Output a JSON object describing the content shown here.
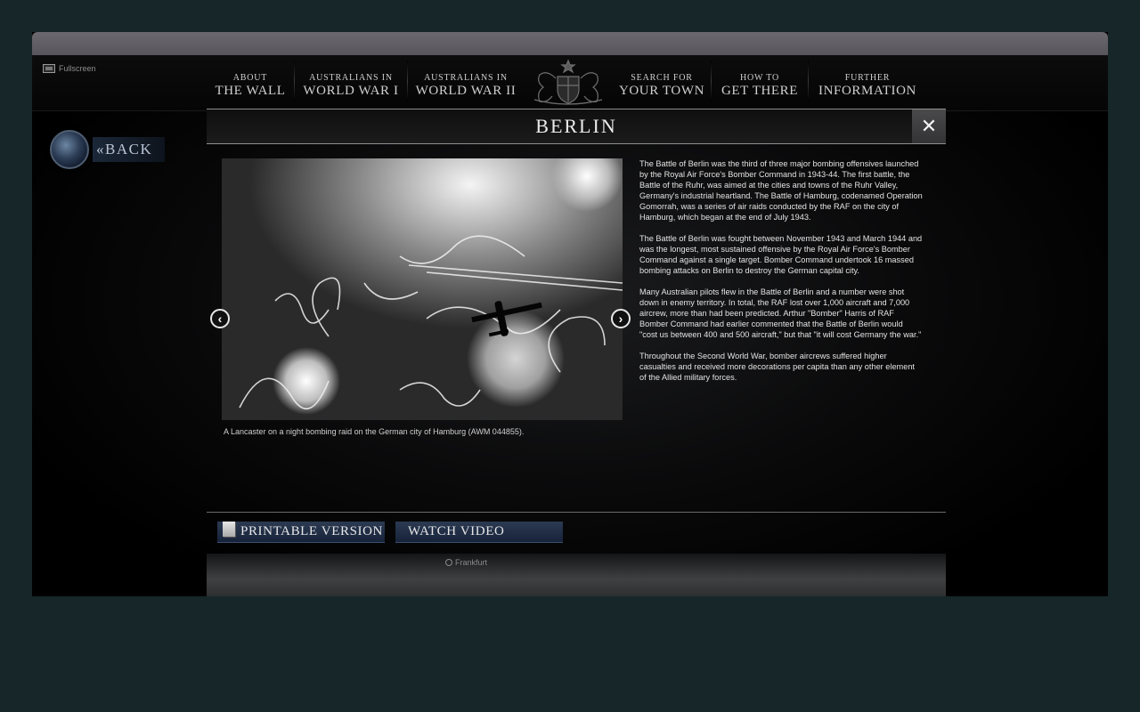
{
  "window": {
    "fullscreen_label": "Fullscreen"
  },
  "nav": {
    "items": [
      {
        "line1": "About",
        "line2": "The Wall"
      },
      {
        "line1": "Australians in",
        "line2": "World War I"
      },
      {
        "line1": "Australians in",
        "line2": "World War II"
      },
      {
        "line1": "Search For",
        "line2": "Your Town"
      },
      {
        "line1": "How To",
        "line2": "Get There"
      },
      {
        "line1": "Further",
        "line2": "Information"
      }
    ]
  },
  "back": {
    "label": "«Back"
  },
  "panel": {
    "title": "Berlin",
    "close_label": "✕",
    "prev_label": "‹",
    "next_label": "›",
    "caption": "A Lancaster on a night bombing raid on the German city of Hamburg (AWM 044855).",
    "paragraphs": [
      "The Battle of Berlin was the third of three major bombing offensives launched by the Royal Air Force's Bomber Command in 1943-44. The first battle, the Battle of the Ruhr, was aimed at the cities and towns of the Ruhr Valley, Germany's industrial heartland. The Battle of Hamburg, codenamed Operation Gomorrah, was a series of air raids conducted by the RAF on the city of Hamburg, which began at the end of July 1943.",
      "The Battle of Berlin was fought between November 1943 and March 1944 and was the longest, most sustained offensive by the Royal Air Force's Bomber Command against a single target. Bomber Command undertook 16 massed bombing attacks on Berlin to destroy the German capital city.",
      "Many Australian pilots flew in the Battle of Berlin and a number were shot down in enemy territory. In total, the RAF lost over 1,000 aircraft and 7,000 aircrew, more than had been predicted. Arthur \"Bomber\" Harris of RAF Bomber Command had earlier commented that the Battle of Berlin would \"cost us between 400 and 500 aircraft,\" but that \"it will cost Germany the war.\"",
      "Throughout the Second World War, bomber aircrews suffered higher casualties and received more decorations per capita than any other element of the Allied military forces."
    ],
    "buttons": {
      "printable": "Printable Version",
      "video": "Watch Video"
    }
  },
  "map": {
    "label": "Frankfurt"
  },
  "icons": {
    "fullscreen": "fullscreen-icon",
    "crest": "coat-of-arms-icon",
    "globe": "globe-icon",
    "close": "close-icon",
    "prev": "chevron-left-icon",
    "next": "chevron-right-icon",
    "document": "document-icon",
    "map_marker": "map-marker-icon"
  },
  "colors": {
    "outer_background": "#172629",
    "button_blue": "#2b3a52",
    "close_button": "#4a4a4c"
  }
}
